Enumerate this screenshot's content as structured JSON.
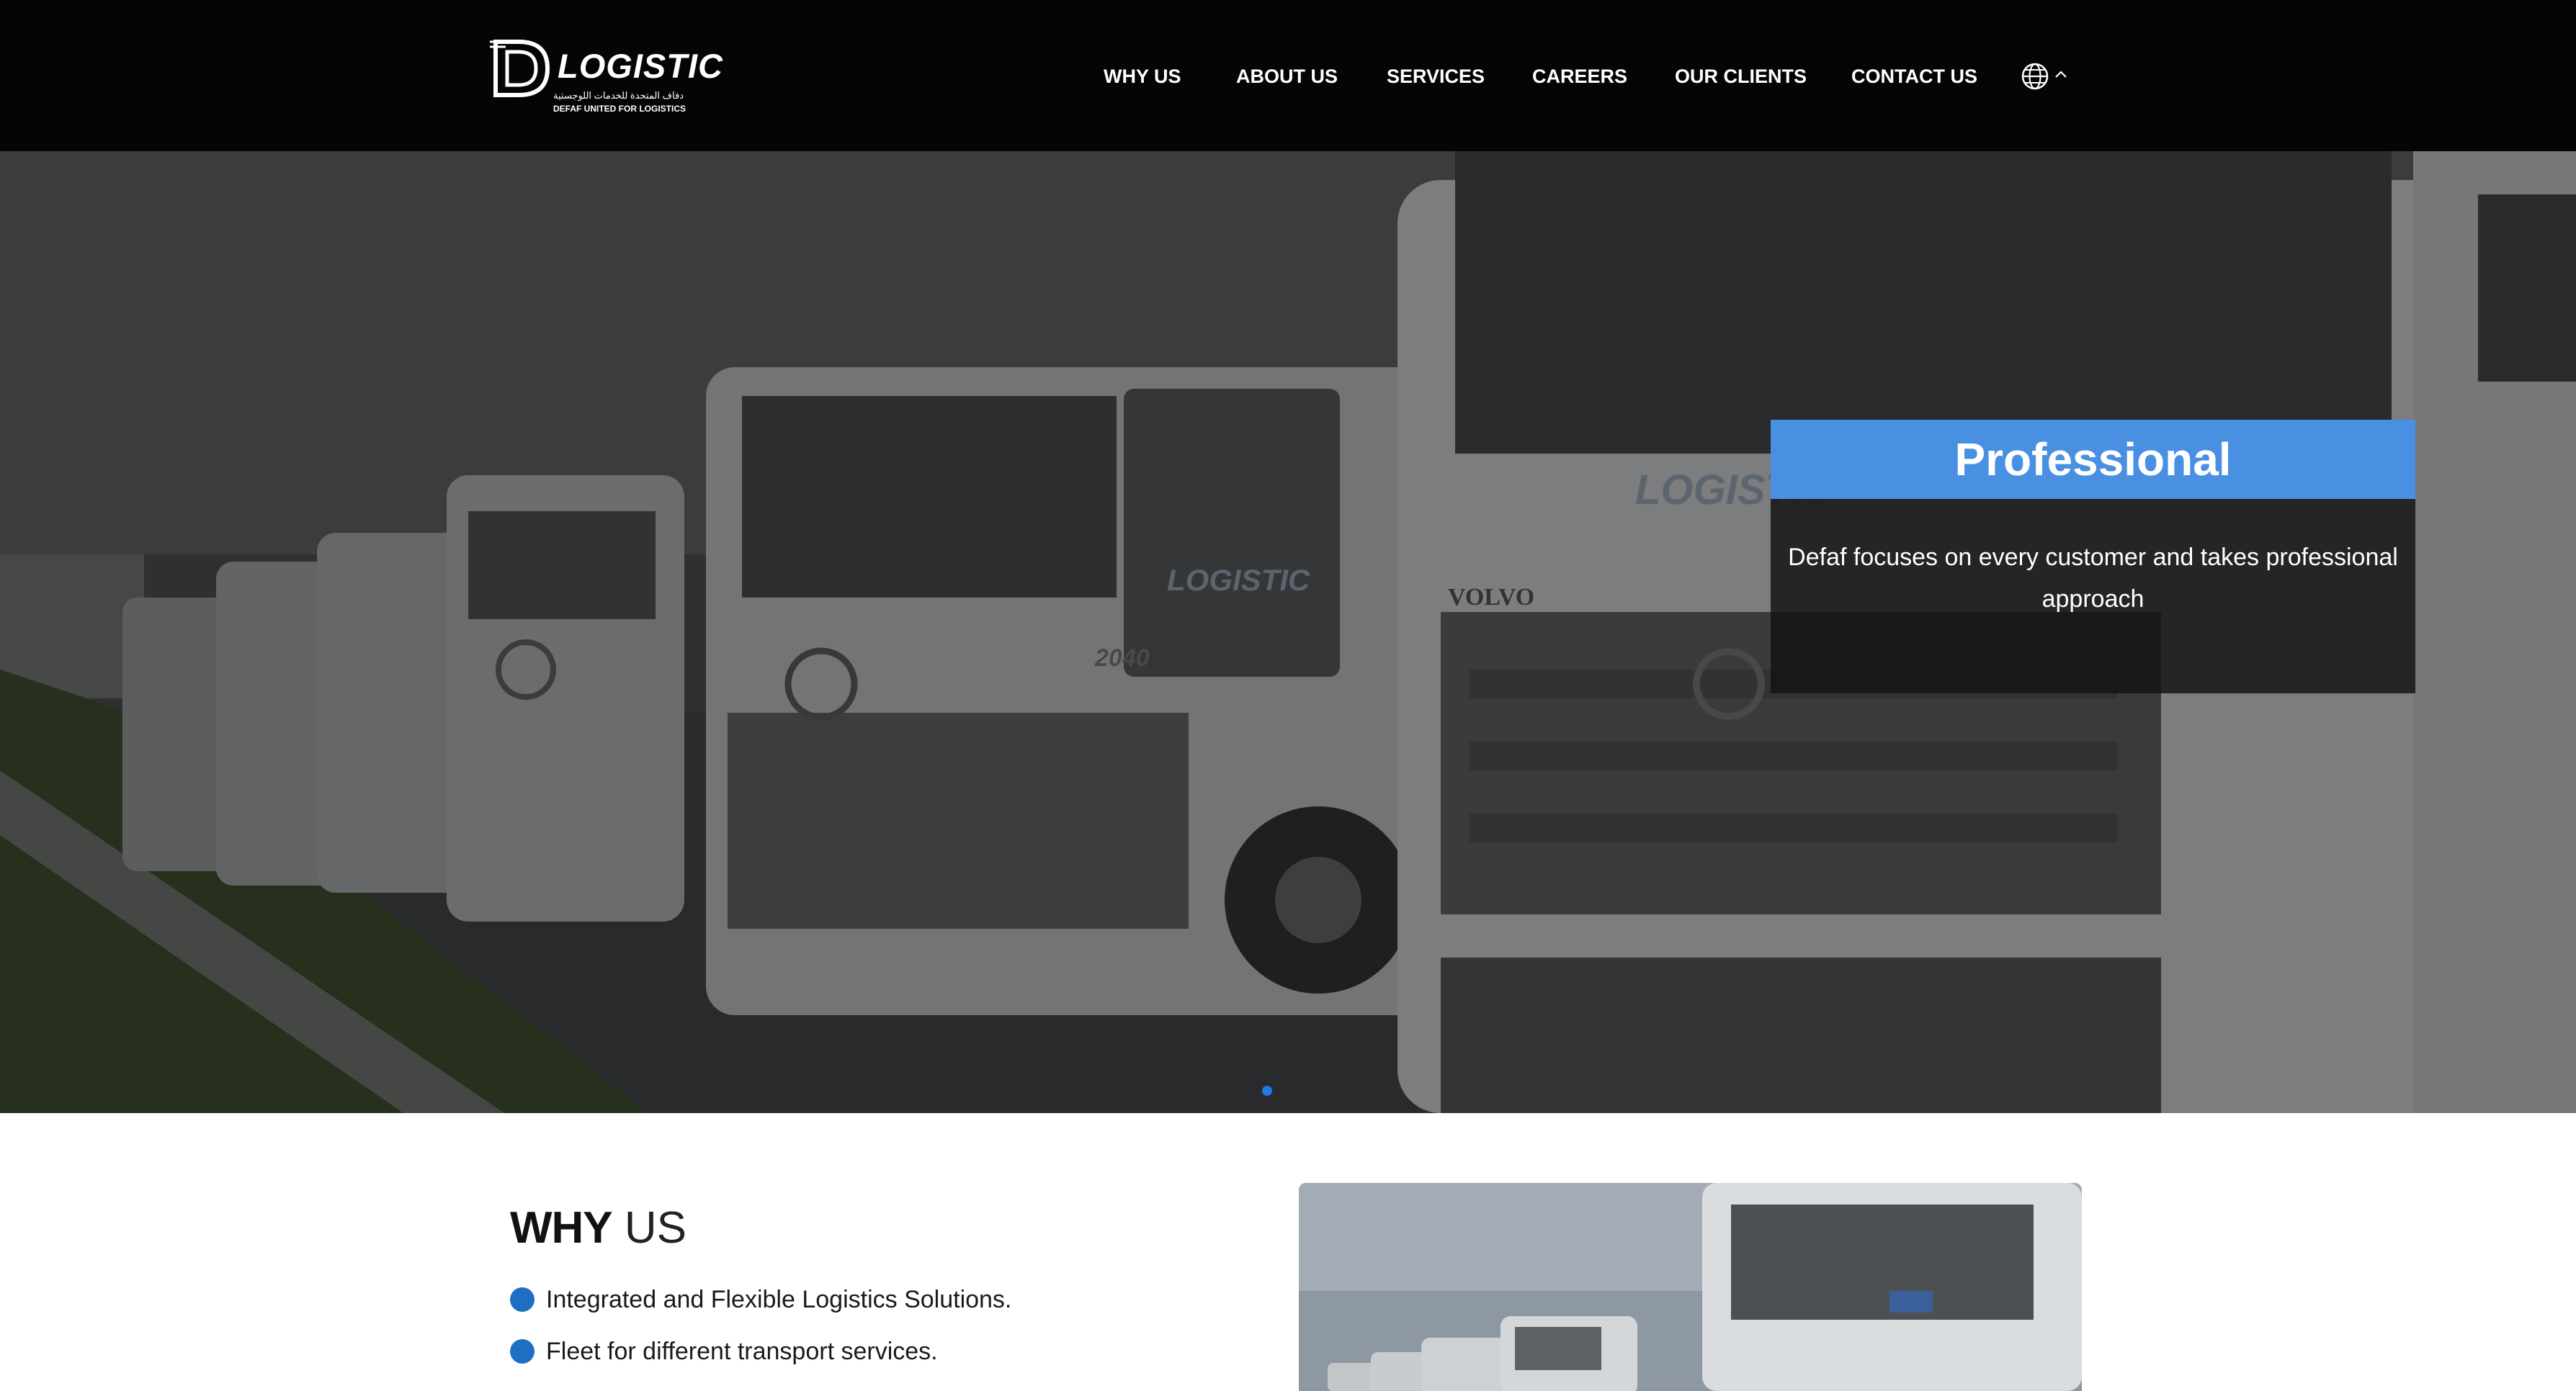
{
  "header": {
    "logo": {
      "wordmark": "LOGISTIC",
      "arabic_name": "دفاف المتحدة للخدمات اللوجستية",
      "english_name": "DEFAF UNITED FOR LOGISTICS"
    },
    "nav": [
      {
        "label": "WHY US"
      },
      {
        "label": "ABOUT US"
      },
      {
        "label": "SERVICES"
      },
      {
        "label": "CAREERS"
      },
      {
        "label": "OUR CLIENTS"
      },
      {
        "label": "CONTACT US"
      }
    ],
    "language_icon": "globe-icon",
    "language_chevron": "chevron-up-icon"
  },
  "hero": {
    "slide_title": "Professional",
    "slide_text": "Defaf focuses on every customer and takes professional approach",
    "accent_color": "#4a90e2",
    "active_dot_color": "#1e7be6",
    "truck_text": {
      "brand": "VOLVO",
      "cab_number": "2040",
      "logo_on_truck": "LOGISTIC"
    }
  },
  "why_us": {
    "title_strong": "WHY",
    "title_light": "US",
    "bullet_color": "#1d6fc4",
    "items": [
      {
        "text": "Integrated and Flexible Logistics Solutions."
      },
      {
        "text": "Fleet for different transport services."
      }
    ]
  }
}
